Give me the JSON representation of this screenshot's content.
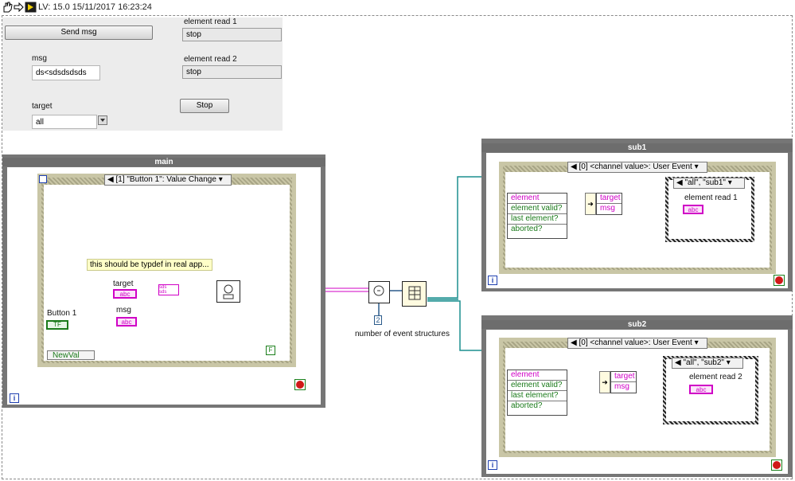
{
  "toolbar": {
    "version_text": "LV: 15.0 15/11/2017 16:23:24"
  },
  "front_panel": {
    "send_button": "Send msg",
    "msg_label": "msg",
    "msg_value": "ds<sdsdsdsds",
    "target_label": "target",
    "target_value": "all",
    "element_read_1_label": "element read 1",
    "element_read_1_value": "stop",
    "element_read_2_label": "element read 2",
    "element_read_2_value": "stop",
    "stop_button": "Stop"
  },
  "main": {
    "title": "main",
    "event_selector": "[1] \"Button 1\": Value Change",
    "note": "this should be typdef in real app...",
    "target_label": "target",
    "msg_label": "msg",
    "button1_label": "Button 1",
    "button1_terminal": "TF",
    "newval": "NewVal",
    "false_const": "F",
    "info_icon": "i",
    "abc": "abc",
    "sds": "sds"
  },
  "mid": {
    "const_value": "2",
    "const_label": "number of event structures"
  },
  "sub1": {
    "title": "sub1",
    "event_selector": "[0] <channel value>: User Event",
    "case_selector": "\"all\", \"sub1\"",
    "rows": [
      "element",
      "element valid?",
      "last element?",
      "aborted?"
    ],
    "unbundle": [
      "target",
      "msg"
    ],
    "indicator_label": "element read 1",
    "abc": "abc",
    "info_icon": "i"
  },
  "sub2": {
    "title": "sub2",
    "event_selector": "[0] <channel value>: User Event",
    "case_selector": "\"all\", \"sub2\"",
    "rows": [
      "element",
      "element valid?",
      "last element?",
      "aborted?"
    ],
    "unbundle": [
      "target",
      "msg"
    ],
    "indicator_label": "element read 2",
    "abc": "abc",
    "info_icon": "i"
  },
  "colors": {
    "string_wire": "#d000c6",
    "channel_wire": "#1c8f8f",
    "bool_wire": "#1a7a1a",
    "refnum_wire": "#2a5a8a"
  }
}
